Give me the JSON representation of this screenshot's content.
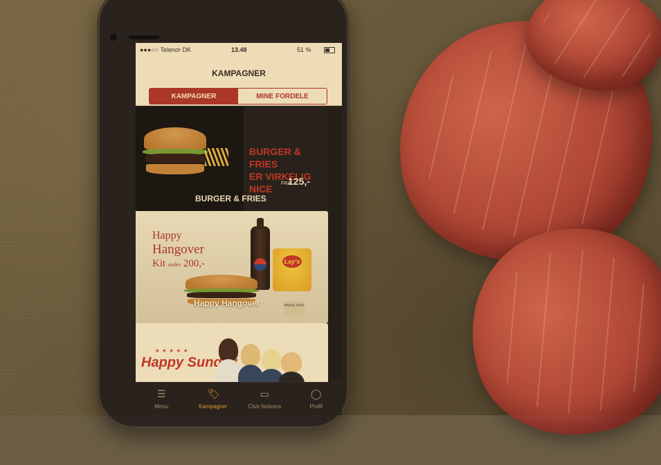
{
  "status_bar": {
    "carrier": "●●●○○ Telenor DK",
    "time": "13.48",
    "battery": "51 %"
  },
  "header": {
    "title": "KAMPAGNER"
  },
  "segmented_control": {
    "active_label": "KAMPAGNER",
    "inactive_label": "MINE FORDELE"
  },
  "promotions": [
    {
      "label": "BURGER & FRIES",
      "headline_line1": "BURGER & FRIES",
      "headline_line2": "ER VIRKELIG",
      "headline_word": "NICE",
      "price_prefix": "FRA",
      "price": "125,-"
    },
    {
      "label": "Happy Hangover",
      "title_line1": "Happy",
      "title_line2": "Hangover",
      "title_line3": "Kit",
      "title_small": "under",
      "title_price": "200,-",
      "chip_brand": "Lay's",
      "bag_label": "PAKKE PRIS"
    },
    {
      "title": "Happy Sunday"
    }
  ],
  "tab_bar": {
    "items": [
      {
        "label": "Menu",
        "icon": "menu-icon"
      },
      {
        "label": "Kampagner",
        "icon": "tag-icon"
      },
      {
        "label": "Club Nelsons",
        "icon": "card-icon"
      },
      {
        "label": "Profil",
        "icon": "profile-icon"
      }
    ],
    "active_index": 1
  },
  "colors": {
    "accent": "#b03a2c",
    "header_bg": "#f5ead7",
    "active_tab": "#e0a23a"
  }
}
